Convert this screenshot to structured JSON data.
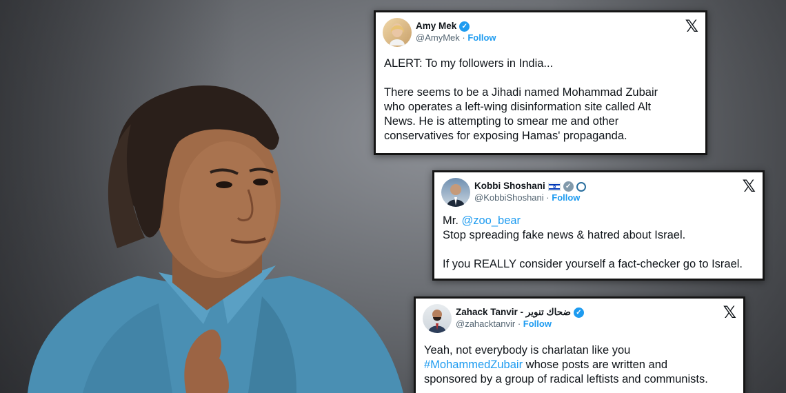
{
  "tweets": [
    {
      "name": "Amy Mek",
      "handle": "@AmyMek",
      "separator": "·",
      "follow": "Follow",
      "logo": "𝕏",
      "lines": [
        "ALERT: To my followers in India...",
        "There seems to be a Jihadi named Mohammad Zubair",
        "who operates a left-wing disinformation site called Alt",
        "News. He is attempting to smear me and other",
        "conservatives for exposing Hamas' propaganda."
      ]
    },
    {
      "name": "Kobbi Shoshani",
      "handle": "@KobbiShoshani",
      "separator": "·",
      "follow": "Follow",
      "logo": "𝕏",
      "mention_prefix": "Mr. ",
      "mention": "@zoo_bear",
      "lines": [
        "Stop spreading fake news & hatred about Israel.",
        "If you REALLY consider yourself a fact-checker go to Israel."
      ]
    },
    {
      "name": "Zahack Tanvir - ضحاك تنوير",
      "handle": "@zahacktanvir",
      "separator": "·",
      "follow": "Follow",
      "logo": "𝕏",
      "line1": "Yeah, not everybody is charlatan like you",
      "hashtag": "#MohammedZubair",
      "line2_rest": " whose posts are written and",
      "line3": "sponsored by a group of radical leftists and communists."
    }
  ],
  "icons": {
    "verified": "✓",
    "accent": "#1d9bf0"
  }
}
